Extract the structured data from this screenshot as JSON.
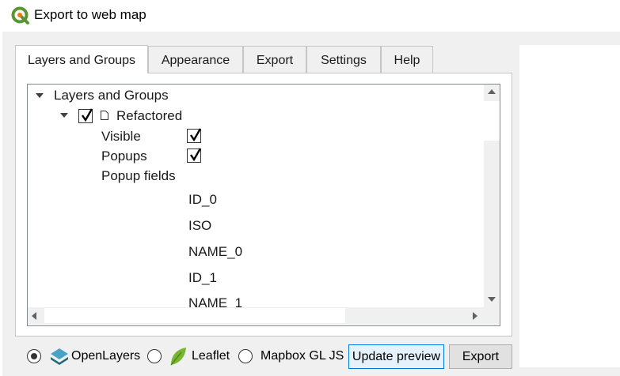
{
  "window": {
    "title": "Export to web map"
  },
  "tabs": [
    {
      "label": "Layers and Groups",
      "active": true
    },
    {
      "label": "Appearance",
      "active": false
    },
    {
      "label": "Export",
      "active": false
    },
    {
      "label": "Settings",
      "active": false
    },
    {
      "label": "Help",
      "active": false
    }
  ],
  "tree": {
    "root_label": "Layers and Groups",
    "layer": {
      "label": "Refactored",
      "checked": true
    },
    "visible": {
      "label": "Visible",
      "checked": true
    },
    "popups": {
      "label": "Popups",
      "checked": true
    },
    "popup_fields_label": "Popup fields",
    "fields": [
      "ID_0",
      "ISO",
      "NAME_0",
      "ID_1",
      "NAME_1"
    ]
  },
  "libraries": {
    "selected": "OpenLayers",
    "options": [
      "OpenLayers",
      "Leaflet",
      "Mapbox GL JS"
    ]
  },
  "buttons": {
    "update_preview": "Update preview",
    "export": "Export"
  },
  "colors": {
    "qgis_green": "#589632",
    "qgis_yellow": "#ee7913",
    "openlayers_blue": "#1f6b75",
    "leaflet_green": "#7ab531",
    "focus_blue": "#0078d7"
  }
}
